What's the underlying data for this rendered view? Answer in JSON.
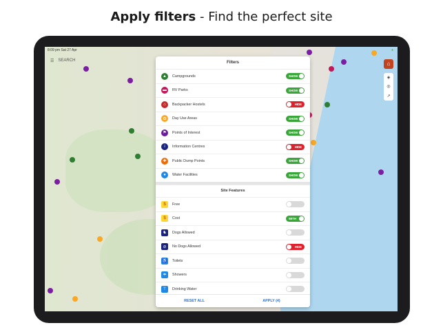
{
  "headline": {
    "bold": "Apply filters",
    "sep": " - ",
    "rest": "Find the perfect site"
  },
  "status": {
    "time": "8:09 pm  Sat 27 Apr",
    "battery": "●"
  },
  "search": {
    "label": "SEARCH"
  },
  "map_controls": {
    "home_icon": "home-icon"
  },
  "panel": {
    "title": "Filters",
    "filters": [
      {
        "label": "Campgrounds",
        "state": "on",
        "toggle": "SHOW",
        "color": "#2e7d32",
        "icon": "tent-icon",
        "glyph": "▲"
      },
      {
        "label": "RV Parks",
        "state": "on",
        "toggle": "SHOW",
        "color": "#c2185b",
        "icon": "rv-icon",
        "glyph": "▬"
      },
      {
        "label": "Backpacker Hostels",
        "state": "off",
        "toggle": "HIDE",
        "color": "#c62828",
        "icon": "hostel-icon",
        "glyph": "⌂"
      },
      {
        "label": "Day Use Areas",
        "state": "on",
        "toggle": "SHOW",
        "color": "#f9a825",
        "icon": "picnic-icon",
        "glyph": "✿"
      },
      {
        "label": "Points of Interest",
        "state": "on",
        "toggle": "SHOW",
        "color": "#6a1b9a",
        "icon": "flag-icon",
        "glyph": "⚑"
      },
      {
        "label": "Information Centres",
        "state": "off",
        "toggle": "HIDE",
        "color": "#1a237e",
        "icon": "info-icon",
        "glyph": "i"
      },
      {
        "label": "Public Dump Points",
        "state": "on",
        "toggle": "SHOW",
        "color": "#ef6c00",
        "icon": "dump-point-icon",
        "glyph": "✚"
      },
      {
        "label": "Water Facilities",
        "state": "on",
        "toggle": "SHOW",
        "color": "#1e88e5",
        "icon": "water-drop-icon",
        "glyph": "●"
      }
    ],
    "features_title": "Site Features",
    "features": [
      {
        "label": "Free",
        "state": "none",
        "toggle": "",
        "color": "#fdd835",
        "icon": "free-icon",
        "glyph": "$"
      },
      {
        "label": "Cost",
        "state": "on",
        "toggle": "WITH",
        "color": "#fdd835",
        "icon": "cost-icon",
        "glyph": "$"
      },
      {
        "label": "Dogs Allowed",
        "state": "none",
        "toggle": "",
        "color": "#1a237e",
        "icon": "dog-icon",
        "glyph": "♞"
      },
      {
        "label": "No Dogs Allowed",
        "state": "off",
        "toggle": "HIDE",
        "color": "#1a237e",
        "icon": "no-dog-icon",
        "glyph": "⊘"
      },
      {
        "label": "Toilets",
        "state": "none",
        "toggle": "",
        "color": "#1e88e5",
        "icon": "toilet-icon",
        "glyph": "♿"
      },
      {
        "label": "Showers",
        "state": "none",
        "toggle": "",
        "color": "#1e88e5",
        "icon": "shower-icon",
        "glyph": "☂"
      },
      {
        "label": "Drinking Water",
        "state": "none",
        "toggle": "",
        "color": "#1e88e5",
        "icon": "tap-icon",
        "glyph": "⊤"
      }
    ],
    "reset_label": "RESET ALL",
    "apply_label": "APPLY (4)"
  }
}
